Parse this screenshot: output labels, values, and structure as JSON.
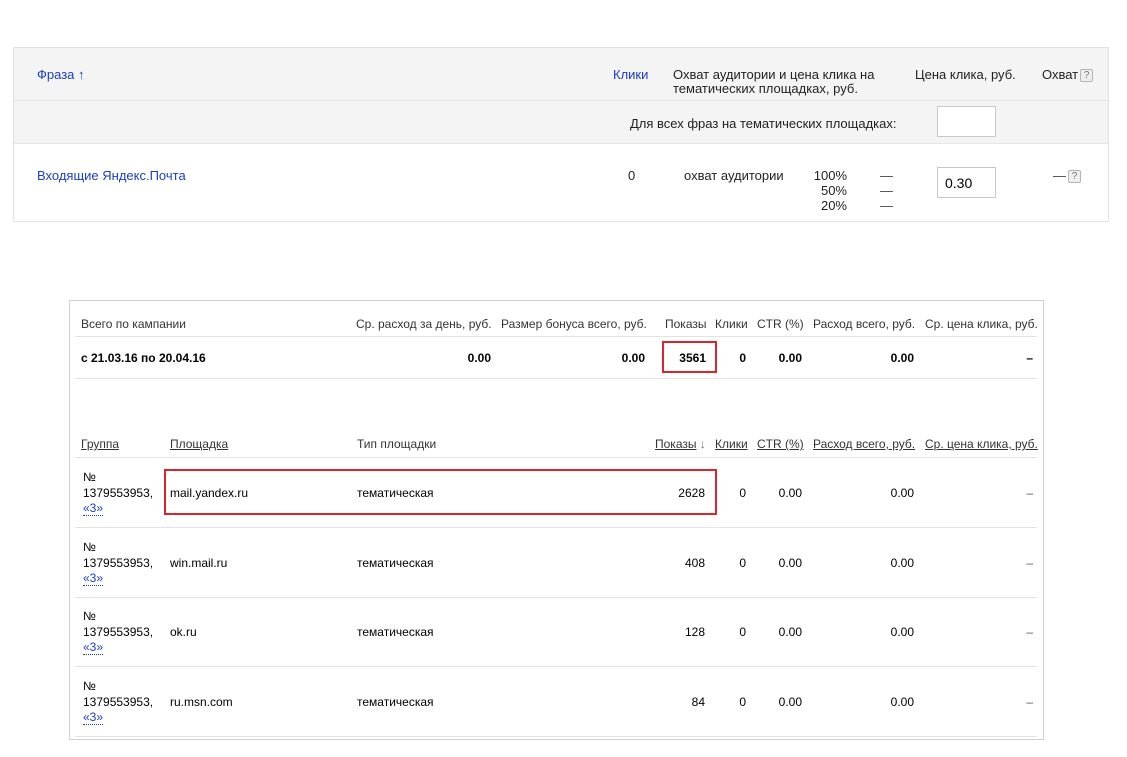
{
  "phrases_table": {
    "col_phrase": "Фраза",
    "col_phrase_sort": "↑",
    "col_clicks": "Клики",
    "col_coverage_line1": "Охват аудитории и цена клика на",
    "col_coverage_line2": "тематических площадках, руб.",
    "col_price": "Цена клика, руб.",
    "col_reach": "Охват",
    "help_glyph": "?",
    "bulk_label": "Для всех фраз на тематических площадках:",
    "bulk_value": "",
    "row": {
      "phrase": "Входящие Яндекс.Почта",
      "clicks": "0",
      "coverage_label": "охват аудитории",
      "coverage_levels": [
        "100%",
        "50%",
        "20%"
      ],
      "coverage_values": [
        "—",
        "—",
        "—"
      ],
      "price": "0.30",
      "reach": "—"
    }
  },
  "campaign_summary": {
    "headers": [
      "Всего по кампании",
      "Ср. расход за день, руб.",
      "Размер бонуса всего, руб.",
      "Показы",
      "Клики",
      "CTR (%)",
      "Расход всего, руб.",
      "Ср. цена клика, руб."
    ],
    "values": [
      "с 21.03.16 по 20.04.16",
      "0.00",
      "0.00",
      "3561",
      "0",
      "0.00",
      "0.00",
      "–"
    ]
  },
  "placements": {
    "headers": {
      "group": "Группа",
      "site": "Площадка",
      "type": "Тип площадки",
      "impressions": "Показы",
      "impressions_sort": "↓",
      "clicks": "Клики",
      "ctr": "CTR (%)",
      "spend": "Расход всего, руб.",
      "avg_cpc": "Ср. цена клика, руб."
    },
    "rows": [
      {
        "group_no": "№",
        "group_id": "1379553953,",
        "group_link": "«3»",
        "site": "mail.yandex.ru",
        "type": "тематическая",
        "impressions": "2628",
        "clicks": "0",
        "ctr": "0.00",
        "spend": "0.00",
        "avg_cpc": "–"
      },
      {
        "group_no": "№",
        "group_id": "1379553953,",
        "group_link": "«3»",
        "site": "win.mail.ru",
        "type": "тематическая",
        "impressions": "408",
        "clicks": "0",
        "ctr": "0.00",
        "spend": "0.00",
        "avg_cpc": "–"
      },
      {
        "group_no": "№",
        "group_id": "1379553953,",
        "group_link": "«3»",
        "site": "ok.ru",
        "type": "тематическая",
        "impressions": "128",
        "clicks": "0",
        "ctr": "0.00",
        "spend": "0.00",
        "avg_cpc": "–"
      },
      {
        "group_no": "№",
        "group_id": "1379553953,",
        "group_link": "«3»",
        "site": "ru.msn.com",
        "type": "тематическая",
        "impressions": "84",
        "clicks": "0",
        "ctr": "0.00",
        "spend": "0.00",
        "avg_cpc": "–"
      }
    ]
  },
  "colors": {
    "link": "#1a3dc1",
    "highlight": "#d9262c",
    "header_bg": "#f4f4f4"
  }
}
